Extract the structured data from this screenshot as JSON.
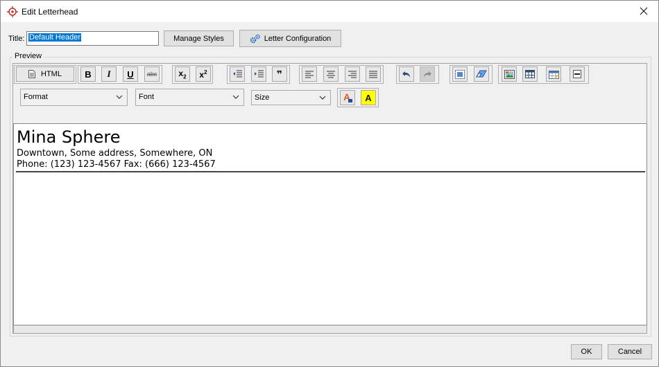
{
  "window": {
    "title": "Edit Letterhead"
  },
  "form": {
    "title_label": "Title:",
    "title_value": "Default Header",
    "manage_styles_label": "Manage Styles",
    "letter_config_label": "Letter Configuration"
  },
  "preview": {
    "group_label": "Preview",
    "toolbar": {
      "html_label": "HTML",
      "buttons": [
        "bold-icon",
        "italic-icon",
        "underline-icon",
        "strikethrough-icon",
        "subscript-icon",
        "superscript-icon",
        "outdent-icon",
        "indent-icon",
        "blockquote-icon",
        "align-left-icon",
        "align-center-icon",
        "align-right-icon",
        "justify-icon",
        "undo-icon",
        "redo-icon",
        "select-all-icon",
        "eraser-icon",
        "image-icon",
        "table-icon",
        "calendar-icon",
        "horizontal-rule-icon"
      ],
      "format_label": "Format",
      "font_label": "Font",
      "size_label": "Size",
      "bold": "B",
      "italic": "I",
      "underline": "U",
      "strike": "abc",
      "sub": "x",
      "sub_index": "2",
      "sup": "x",
      "sup_index": "2",
      "quote": "❞",
      "text_color_letter": "A",
      "bg_color_letter": "A",
      "colors": {
        "text_color_accent": "#e85a1c",
        "bg_color_accent": "#ffff00",
        "icon_blue": "#1f4e9e"
      }
    },
    "letterhead": {
      "company": "Mina Sphere",
      "address": "Downtown, Some address, Somewhere, ON",
      "phone": "Phone: (123) 123-4567 Fax: (666) 123-4567"
    }
  },
  "footer": {
    "ok_label": "OK",
    "cancel_label": "Cancel"
  }
}
